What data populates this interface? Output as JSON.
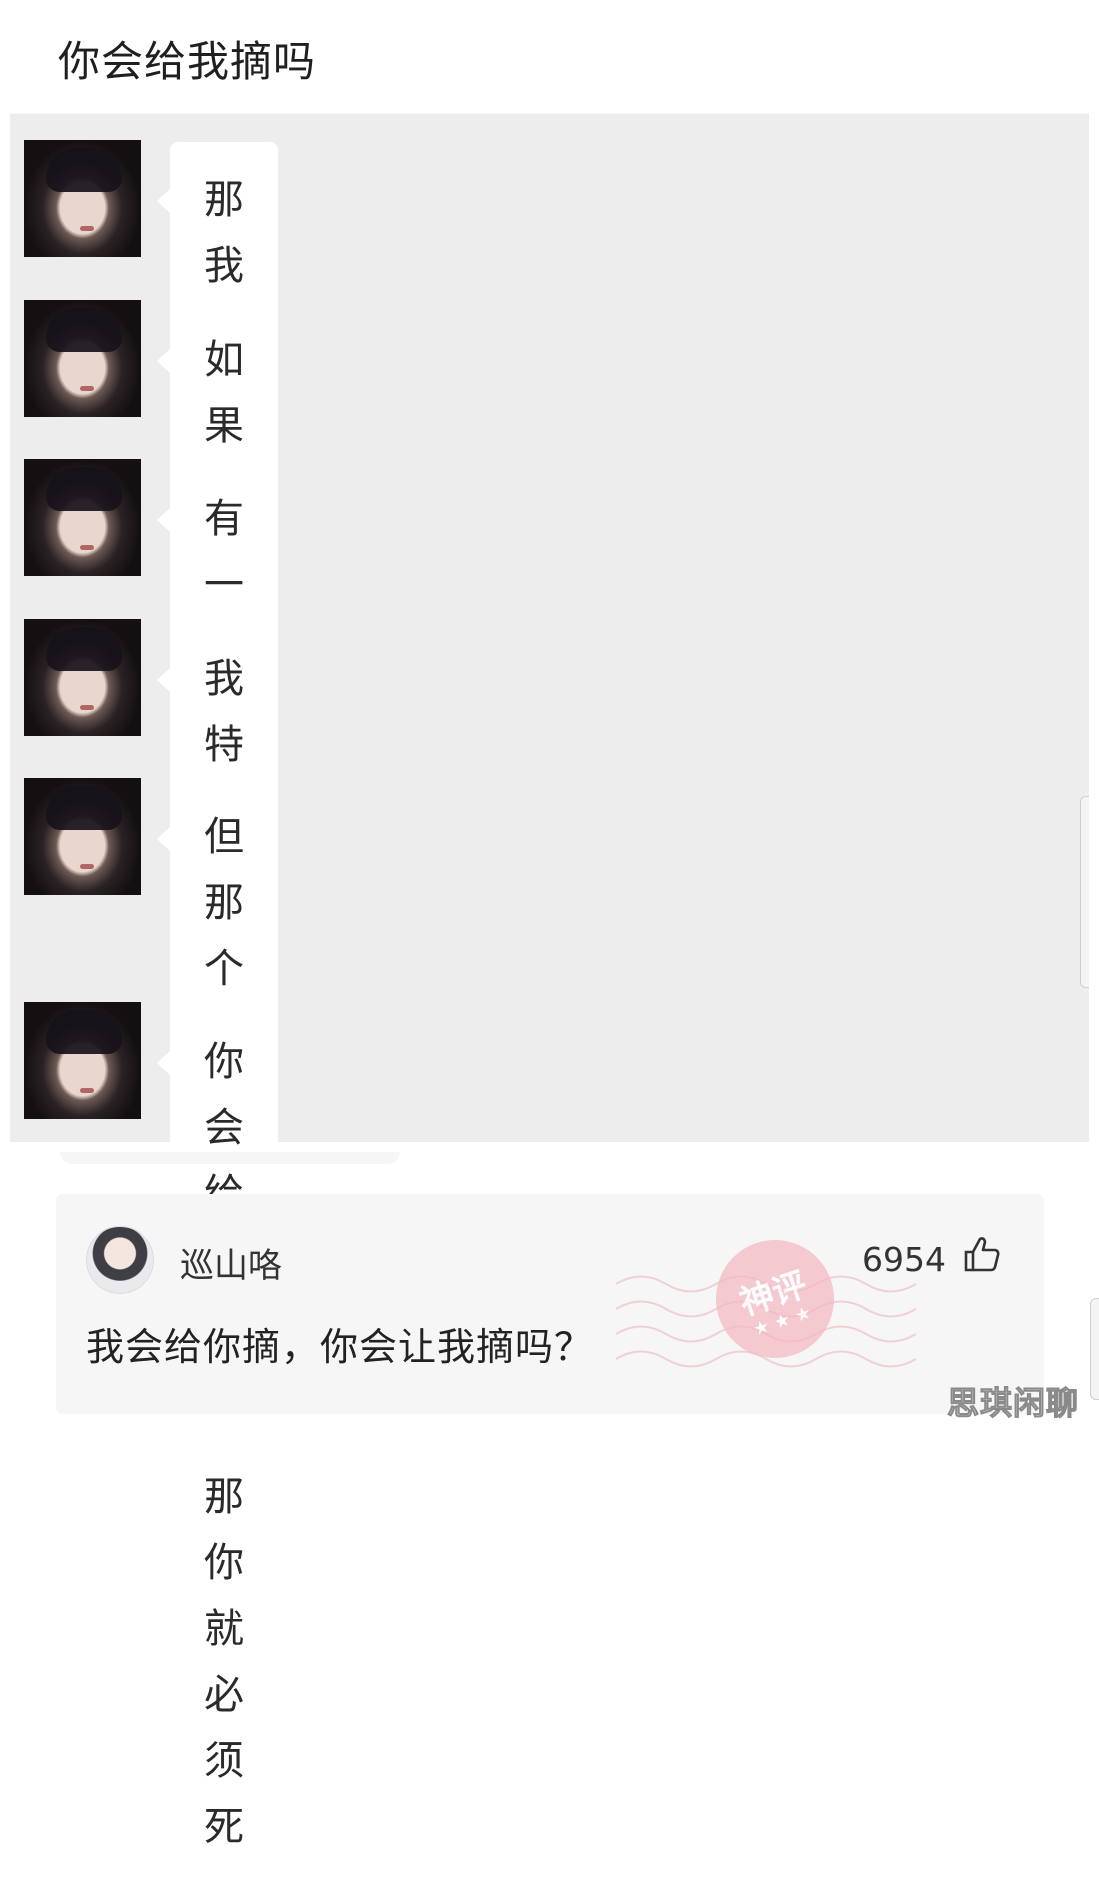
{
  "post": {
    "title": "你会给我摘吗"
  },
  "messages": [
    {
      "text": "那我问你"
    },
    {
      "text": "如果你很爱很爱我"
    },
    {
      "text": "有一天"
    },
    {
      "text": "我特别喜欢悬崖上的一朵花"
    },
    {
      "text": "但那个花你要想摘到它那你就必须\n死"
    },
    {
      "text": "你会给我摘吗"
    }
  ],
  "comment": {
    "username": "巡山咯",
    "likes": "6954",
    "text": "我会给你摘，你会让我摘吗？",
    "badge": "神评",
    "badge_stars": "★ ★ ★"
  },
  "watermark": "思琪闲聊"
}
